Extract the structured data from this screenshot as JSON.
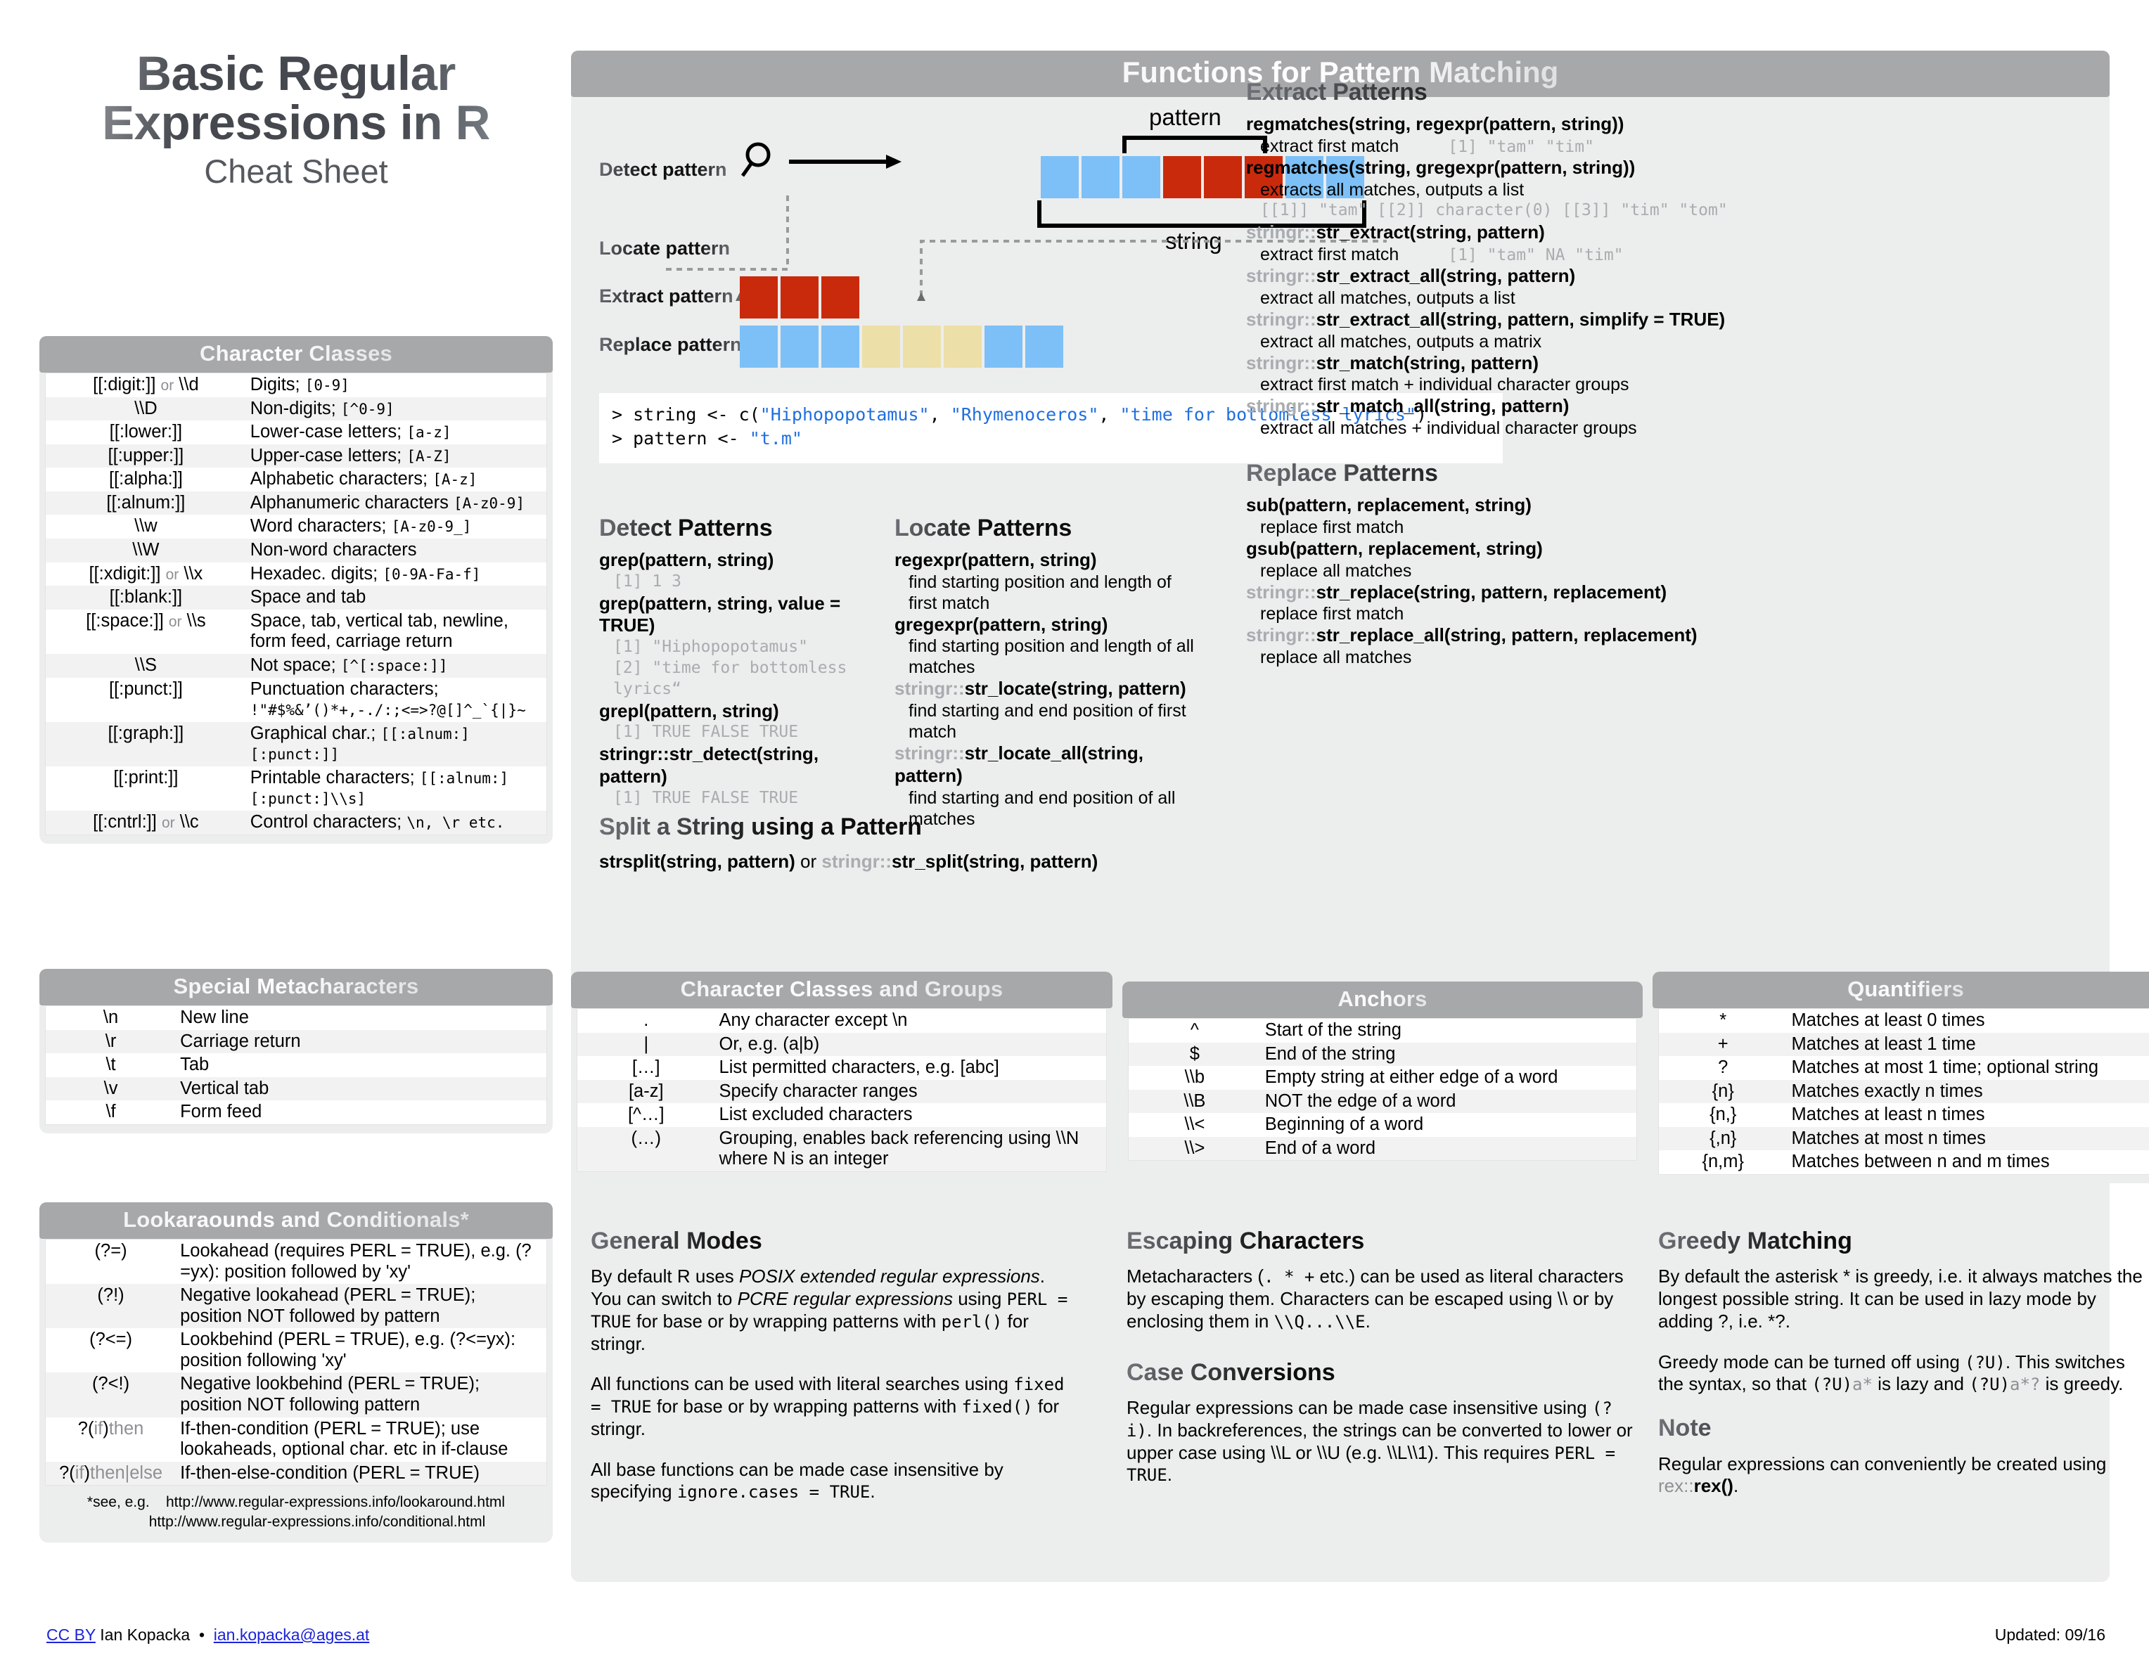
{
  "title": {
    "line1": "Basic Regular",
    "line2": "Expressions in R",
    "subtitle": "Cheat Sheet"
  },
  "character_classes": {
    "heading": "Character Classes",
    "rows": [
      {
        "key": "[[:digit:]]",
        "key_or": "or",
        "key2": "\\\\d",
        "desc": "Digits;",
        "code": "[0-9]"
      },
      {
        "key": "\\\\D",
        "key_or": "",
        "key2": "",
        "desc": "Non-digits;",
        "code": "[^0-9]"
      },
      {
        "key": "[[:lower:]]",
        "key_or": "",
        "key2": "",
        "desc": "Lower-case letters;",
        "code": "[a-z]"
      },
      {
        "key": "[[:upper:]]",
        "key_or": "",
        "key2": "",
        "desc": "Upper-case letters;",
        "code": "[A-Z]"
      },
      {
        "key": "[[:alpha:]]",
        "key_or": "",
        "key2": "",
        "desc": "Alphabetic characters;",
        "code": "[A-z]"
      },
      {
        "key": "[[:alnum:]]",
        "key_or": "",
        "key2": "",
        "desc": "Alphanumeric characters",
        "code": "[A-z0-9]"
      },
      {
        "key": "\\\\w",
        "key_or": "",
        "key2": "",
        "desc": "Word characters;",
        "code": "[A-z0-9_]"
      },
      {
        "key": "\\\\W",
        "key_or": "",
        "key2": "",
        "desc": "Non-word characters",
        "code": ""
      },
      {
        "key": "[[:xdigit:]]",
        "key_or": "or",
        "key2": "\\\\x",
        "desc": "Hexadec. digits;",
        "code": "[0-9A-Fa-f]"
      },
      {
        "key": "[[:blank:]]",
        "key_or": "",
        "key2": "",
        "desc": "Space and tab",
        "code": ""
      },
      {
        "key": "[[:space:]]",
        "key_or": "or",
        "key2": "\\\\s",
        "desc": "Space, tab, vertical tab, newline, form feed, carriage return",
        "code": ""
      },
      {
        "key": "\\\\S",
        "key_or": "",
        "key2": "",
        "desc": "Not space;",
        "code": "[^[:space:]]"
      },
      {
        "key": "[[:punct:]]",
        "key_or": "",
        "key2": "",
        "desc": "Punctuation characters;",
        "code": "!\"#$%&’()*+,-./:;<=>?@[]^_`{|}~"
      },
      {
        "key": "[[:graph:]]",
        "key_or": "",
        "key2": "",
        "desc": "Graphical char.;",
        "code": "[[:alnum:][:punct:]]"
      },
      {
        "key": "[[:print:]]",
        "key_or": "",
        "key2": "",
        "desc": "Printable characters;",
        "code": "[[:alnum:][:punct:]\\\\s]"
      },
      {
        "key": "[[:cntrl:]]",
        "key_or": "or",
        "key2": "\\\\c",
        "desc": "Control characters;",
        "code": "\\n, \\r etc."
      }
    ]
  },
  "special_metacharacters": {
    "heading": "Special Metacharacters",
    "rows": [
      {
        "key": "\\n",
        "desc": "New line"
      },
      {
        "key": "\\r",
        "desc": "Carriage return"
      },
      {
        "key": "\\t",
        "desc": "Tab"
      },
      {
        "key": "\\v",
        "desc": "Vertical tab"
      },
      {
        "key": "\\f",
        "desc": "Form feed"
      }
    ]
  },
  "lookarounds": {
    "heading": "Lookaraounds and Conditionals*",
    "rows": [
      {
        "key": "(?=)",
        "desc": "Lookahead (requires PERL = TRUE), e.g. (?=yx): position followed by 'xy'"
      },
      {
        "key": "(?!)",
        "desc": "Negative lookahead (PERL = TRUE); position NOT followed by pattern"
      },
      {
        "key": "(?<=)",
        "desc": "Lookbehind (PERL = TRUE), e.g. (?<=yx): position following 'xy'"
      },
      {
        "key": "(?<!)",
        "desc": "Negative lookbehind (PERL = TRUE); position NOT following pattern"
      },
      {
        "key": "?(if)then",
        "desc": "If-then-condition (PERL = TRUE); use lookaheads, optional char. etc in if-clause"
      },
      {
        "key": "?(if)then|else",
        "desc": "If-then-else-condition (PERL = TRUE)"
      }
    ],
    "footnote_label": "*see, e.g.",
    "footnote_links": [
      "http://www.regular-expressions.info/lookaround.html",
      "http://www.regular-expressions.info/conditional.html"
    ]
  },
  "footer": {
    "license": "CC BY",
    "author": "Ian Kopacka",
    "separator": "•",
    "email": "ian.kopacka@ages.at",
    "updated": "Updated: 09/16"
  },
  "main": {
    "heading": "Functions  for Pattern Matching",
    "diagram": {
      "rows": [
        {
          "label": "Detect pattern"
        },
        {
          "label": "Locate pattern"
        },
        {
          "label": "Extract pattern"
        },
        {
          "label": "Replace pattern"
        }
      ],
      "brace_pattern_label": "pattern",
      "brace_string_label": "string",
      "search_icon": "magnifier-icon"
    },
    "code": {
      "prompt1": ">",
      "line1_a": "string <- c(",
      "s1": "\"Hiphopopotamus\"",
      "sep1": ", ",
      "s2": "\"Rhymenoceros\"",
      "sep2": ", ",
      "s3": "\"time for bottomless lyrics\"",
      "line1_b": ")",
      "prompt2": ">",
      "line2_a": "pattern <- ",
      "s4": "\"t.m\""
    },
    "detect": {
      "heading": "Detect Patterns",
      "items": [
        {
          "fn": "grep(pattern, string)",
          "ns": "",
          "out": [
            "[1] 1 3"
          ],
          "desc": ""
        },
        {
          "fn": "grep(pattern, string, value = TRUE)",
          "ns": "",
          "out": [
            "[1] \"Hiphopopotamus\"",
            "[2] \"time for bottomless lyrics“"
          ],
          "desc": ""
        },
        {
          "fn": "grepl(pattern, string)",
          "ns": "",
          "out": [
            "[1]  TRUE FALSE  TRUE"
          ],
          "desc": ""
        },
        {
          "fn": "stringr::str_detect(string, pattern)",
          "ns": "",
          "out": [
            "[1]  TRUE FALSE  TRUE"
          ],
          "desc": ""
        }
      ]
    },
    "locate": {
      "heading": "Locate Patterns",
      "items": [
        {
          "ns": "",
          "fn": "regexpr(pattern, string)",
          "desc": "find starting position and length of first match"
        },
        {
          "ns": "",
          "fn": "gregexpr(pattern, string)",
          "desc": "find starting position and length of all matches"
        },
        {
          "ns": "stringr::",
          "fn": "str_locate(string, pattern)",
          "desc": "find starting and end position of first match"
        },
        {
          "ns": "stringr::",
          "fn": "str_locate_all(string, pattern)",
          "desc": "find starting and end position of all matches"
        }
      ]
    },
    "split": {
      "heading": "Split a String using a Pattern",
      "fn_a": "strsplit(string, pattern)",
      "or": " or ",
      "ns": "stringr::",
      "fn_b": "str_split(string, pattern)"
    },
    "extract": {
      "heading": "Extract Patterns",
      "items": [
        {
          "ns": "",
          "fn": "regmatches(string, regexpr(pattern, string))",
          "desc": "extract first match",
          "out": "[1] \"tam\" \"tim\""
        },
        {
          "ns": "",
          "fn": "regmatches(string, gregexpr(pattern, string))",
          "desc": "extracts all matches, outputs a list",
          "out2": "[[1]] \"tam\" [[2]] character(0) [[3]] \"tim\" \"tom\""
        },
        {
          "ns": "stringr::",
          "fn": "str_extract(string, pattern)",
          "desc": "extract first match",
          "out": "[1] \"tam\" NA  \"tim\""
        },
        {
          "ns": "stringr::",
          "fn": "str_extract_all(string, pattern)",
          "desc": "extract all matches, outputs a list"
        },
        {
          "ns": "stringr::",
          "fn": "str_extract_all(string, pattern, simplify = TRUE)",
          "desc": "extract all matches, outputs a matrix"
        },
        {
          "ns": "stringr::",
          "fn": "str_match(string, pattern)",
          "desc": "extract first match + individual character groups"
        },
        {
          "ns": "stringr::",
          "fn": "str_match_all(string, pattern)",
          "desc": "extract all matches + individual character groups"
        }
      ]
    },
    "replace": {
      "heading": "Replace Patterns",
      "items": [
        {
          "ns": "",
          "fn": "sub(pattern, replacement, string)",
          "desc": "replace first match"
        },
        {
          "ns": "",
          "fn": "gsub(pattern, replacement, string)",
          "desc": "replace all matches"
        },
        {
          "ns": "stringr::",
          "fn": "str_replace(string, pattern, replacement)",
          "desc": "replace first match"
        },
        {
          "ns": "stringr::",
          "fn": "str_replace_all(string, pattern, replacement)",
          "desc": "replace all matches"
        }
      ]
    }
  },
  "classes_groups": {
    "heading": "Character Classes and Groups",
    "rows": [
      {
        "key": ".",
        "desc": "Any character except \\n"
      },
      {
        "key": "|",
        "desc": "Or, e.g. (a|b)"
      },
      {
        "key": "[…]",
        "desc": "List permitted characters, e.g. [abc]"
      },
      {
        "key": "[a-z]",
        "desc": "Specify character ranges"
      },
      {
        "key": "[^…]",
        "desc": "List excluded characters"
      },
      {
        "key": "(…)",
        "desc": "Grouping, enables back referencing using \\\\N where N is an integer"
      }
    ]
  },
  "anchors": {
    "heading": "Anchors",
    "rows": [
      {
        "key": "^",
        "desc": "Start of the string"
      },
      {
        "key": "$",
        "desc": "End of the string"
      },
      {
        "key": "\\\\b",
        "desc": "Empty string at either edge of a word"
      },
      {
        "key": "\\\\B",
        "desc": "NOT the edge of a word"
      },
      {
        "key": "\\\\<",
        "desc": "Beginning of a word"
      },
      {
        "key": "\\\\>",
        "desc": "End of a word"
      }
    ]
  },
  "quantifiers": {
    "heading": "Quantifiers",
    "rows": [
      {
        "key": "*",
        "desc": "Matches at least 0 times"
      },
      {
        "key": "+",
        "desc": "Matches at least 1 time"
      },
      {
        "key": "?",
        "desc": "Matches at most 1 time; optional string"
      },
      {
        "key": "{n}",
        "desc": "Matches exactly n times"
      },
      {
        "key": "{n,}",
        "desc": "Matches at least n times"
      },
      {
        "key": "{,n}",
        "desc": "Matches at most n times"
      },
      {
        "key": "{n,m}",
        "desc": "Matches between n and m times"
      }
    ]
  },
  "general_modes": {
    "heading": "General Modes",
    "p1_a": "By default R uses ",
    "p1_i1": "POSIX extended regular expressions",
    "p1_b": ". You can switch to ",
    "p1_i2": "PCRE regular expressions",
    "p1_c": " using ",
    "p1_code1": "PERL = TRUE",
    "p1_d": " for base or by wrapping patterns with ",
    "p1_code2": "perl()",
    "p1_e": " for stringr.",
    "p2_a": "All functions can be used with literal searches using ",
    "p2_code1": "fixed = TRUE",
    "p2_b": " for base or by wrapping patterns with ",
    "p2_code2": "fixed()",
    "p2_c": " for stringr.",
    "p3_a": "All base functions can be made case insensitive by specifying ",
    "p3_code1": "ignore.cases = TRUE",
    "p3_b": "."
  },
  "escaping": {
    "heading": "Escaping Characters",
    "p1_a": "Metacharacters (",
    "p1_code1": ". * +",
    "p1_b": " etc.) can be used as literal characters by escaping them. Characters can be escaped using \\\\ or by enclosing them in ",
    "p1_code2": "\\\\Q...\\\\E",
    "p1_c": ".",
    "case_heading": "Case Conversions",
    "p2_a": "Regular expressions can be made case insensitive using ",
    "p2_code1": "(?i)",
    "p2_b": ". In backreferences, the strings can be converted to lower or upper case using \\\\L or \\\\U (e.g. \\\\L\\\\1). This requires ",
    "p2_code2": "PERL = TRUE",
    "p2_c": "."
  },
  "greedy": {
    "heading": "Greedy Matching",
    "p1": "By default the asterisk * is greedy, i.e. it always matches the longest possible string. It can be used in lazy mode by adding ?, i.e. *?.",
    "p2_a": "Greedy mode can be turned off using ",
    "p2_code1": "(?U)",
    "p2_b": ". This switches the syntax, so that ",
    "p2_code2": "(?U)",
    "p2_grey1": "a*",
    "p2_c": " is lazy and ",
    "p2_code3": "(?U)",
    "p2_grey2": "a*?",
    "p2_d": " is greedy.",
    "note_heading": "Note",
    "p3_a": "Regular expressions can conveniently be created using ",
    "p3_ns": "rex::",
    "p3_fn": "rex()",
    "p3_b": "."
  }
}
